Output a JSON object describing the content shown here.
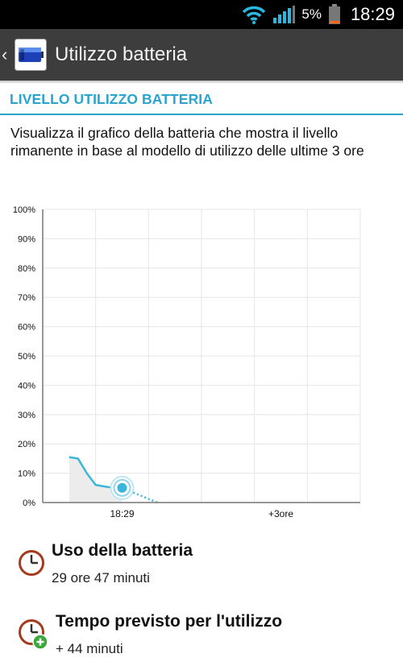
{
  "status_bar": {
    "battery_percent": "5%",
    "time": "18:29",
    "icons": [
      "wifi-icon",
      "signal-icon",
      "battery-icon"
    ]
  },
  "action_bar": {
    "title": "Utilizzo batteria",
    "icon": "battery-app-icon"
  },
  "section": {
    "header": "LIVELLO UTILIZZO BATTERIA",
    "description": "Visualizza il grafico della batteria che mostra il livello rimanente in base al modello di utilizzo delle ultime 3 ore"
  },
  "chart_data": {
    "type": "line",
    "y_ticks": [
      "100%",
      "90%",
      "80%",
      "70%",
      "60%",
      "50%",
      "40%",
      "30%",
      "20%",
      "10%",
      "0%"
    ],
    "x_tick_labels": [
      "18:29",
      "+3ore"
    ],
    "ylim": [
      0,
      100
    ],
    "grid": true,
    "series": [
      {
        "style": "solid",
        "x_minutes": [
          -60,
          -50,
          -40,
          -30,
          -20,
          -10,
          0
        ],
        "values": [
          15.5,
          15,
          10,
          6,
          5.5,
          5,
          5
        ]
      },
      {
        "style": "dotted",
        "x_minutes": [
          0,
          40
        ],
        "values": [
          5,
          0
        ]
      }
    ],
    "current_marker": {
      "x_minutes": 0,
      "value": 5
    },
    "colors": {
      "line": "#3bb5dc",
      "fill": "#ececec",
      "grid": "#e6e6e6",
      "axis": "#777777"
    }
  },
  "info": {
    "usage": {
      "title": "Uso della batteria",
      "value": "29 ore 47 minuti",
      "icon": "clock-icon"
    },
    "estimate": {
      "title": "Tempo previsto per l'utilizzo",
      "value": "+ 44 minuti",
      "icon": "clock-plus-icon"
    }
  }
}
